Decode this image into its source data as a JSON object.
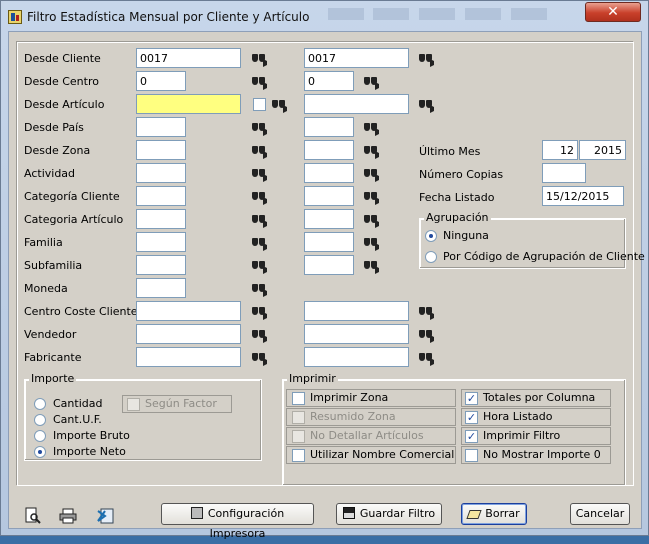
{
  "window": {
    "title": "Filtro Estadística Mensual por Cliente y Artículo",
    "close": "✕"
  },
  "rows": [
    {
      "label": "Desde Cliente",
      "from": "0017",
      "to": "0017"
    },
    {
      "label": "Desde Centro",
      "from": "0",
      "to": "0"
    },
    {
      "label": "Desde Artículo",
      "from": "",
      "to": ""
    },
    {
      "label": "Desde País",
      "from": "",
      "to": ""
    },
    {
      "label": "Desde Zona",
      "from": "",
      "to": ""
    },
    {
      "label": "Actividad",
      "from": "",
      "to": ""
    },
    {
      "label": "Categoría Cliente",
      "from": "",
      "to": ""
    },
    {
      "label": "Categoria Artículo",
      "from": "",
      "to": ""
    },
    {
      "label": "Familia",
      "from": "",
      "to": ""
    },
    {
      "label": "Subfamilia",
      "from": "",
      "to": ""
    },
    {
      "label": "Moneda",
      "from": ""
    },
    {
      "label": "Centro Coste Cliente",
      "from": "",
      "to": ""
    },
    {
      "label": "Vendedor",
      "from": "",
      "to": ""
    },
    {
      "label": "Fabricante",
      "from": "",
      "to": ""
    }
  ],
  "right": {
    "ultimo_mes_label": "Último Mes",
    "mes": "12",
    "anio": "2015",
    "numero_copias_label": "Número Copias",
    "copias": "",
    "fecha_label": "Fecha Listado",
    "fecha": "15/12/2015"
  },
  "agrupacion": {
    "title": "Agrupación",
    "options": [
      "Ninguna",
      "Por Código de Agrupación de Cliente"
    ],
    "selected": "Ninguna"
  },
  "importe": {
    "title": "Importe",
    "options": [
      "Cantidad",
      "Cant.U.F.",
      "Importe Bruto",
      "Importe Neto"
    ],
    "selected": "Importe Neto",
    "segun_factor": "Según Factor"
  },
  "imprimir": {
    "title": "Imprimir",
    "left": [
      {
        "label": "Imprimir Zona",
        "checked": false,
        "enabled": true
      },
      {
        "label": "Resumido Zona",
        "checked": false,
        "enabled": false
      },
      {
        "label": "No Detallar Artículos",
        "checked": false,
        "enabled": false
      },
      {
        "label": "Utilizar Nombre Comercial",
        "checked": false,
        "enabled": true
      }
    ],
    "right": [
      {
        "label": "Totales por Columna",
        "checked": true
      },
      {
        "label": "Hora Listado",
        "checked": true
      },
      {
        "label": "Imprimir Filtro",
        "checked": true
      },
      {
        "label": "No Mostrar Importe 0",
        "checked": false
      }
    ]
  },
  "buttons": {
    "config": "Configuración Impresora",
    "guardar": "Guardar Filtro",
    "borrar": "Borrar",
    "cancelar": "Cancelar"
  },
  "icons": {
    "preview": "print-preview-icon",
    "print": "printer-icon",
    "excel": "excel-icon",
    "search": "binoculars-icon"
  }
}
